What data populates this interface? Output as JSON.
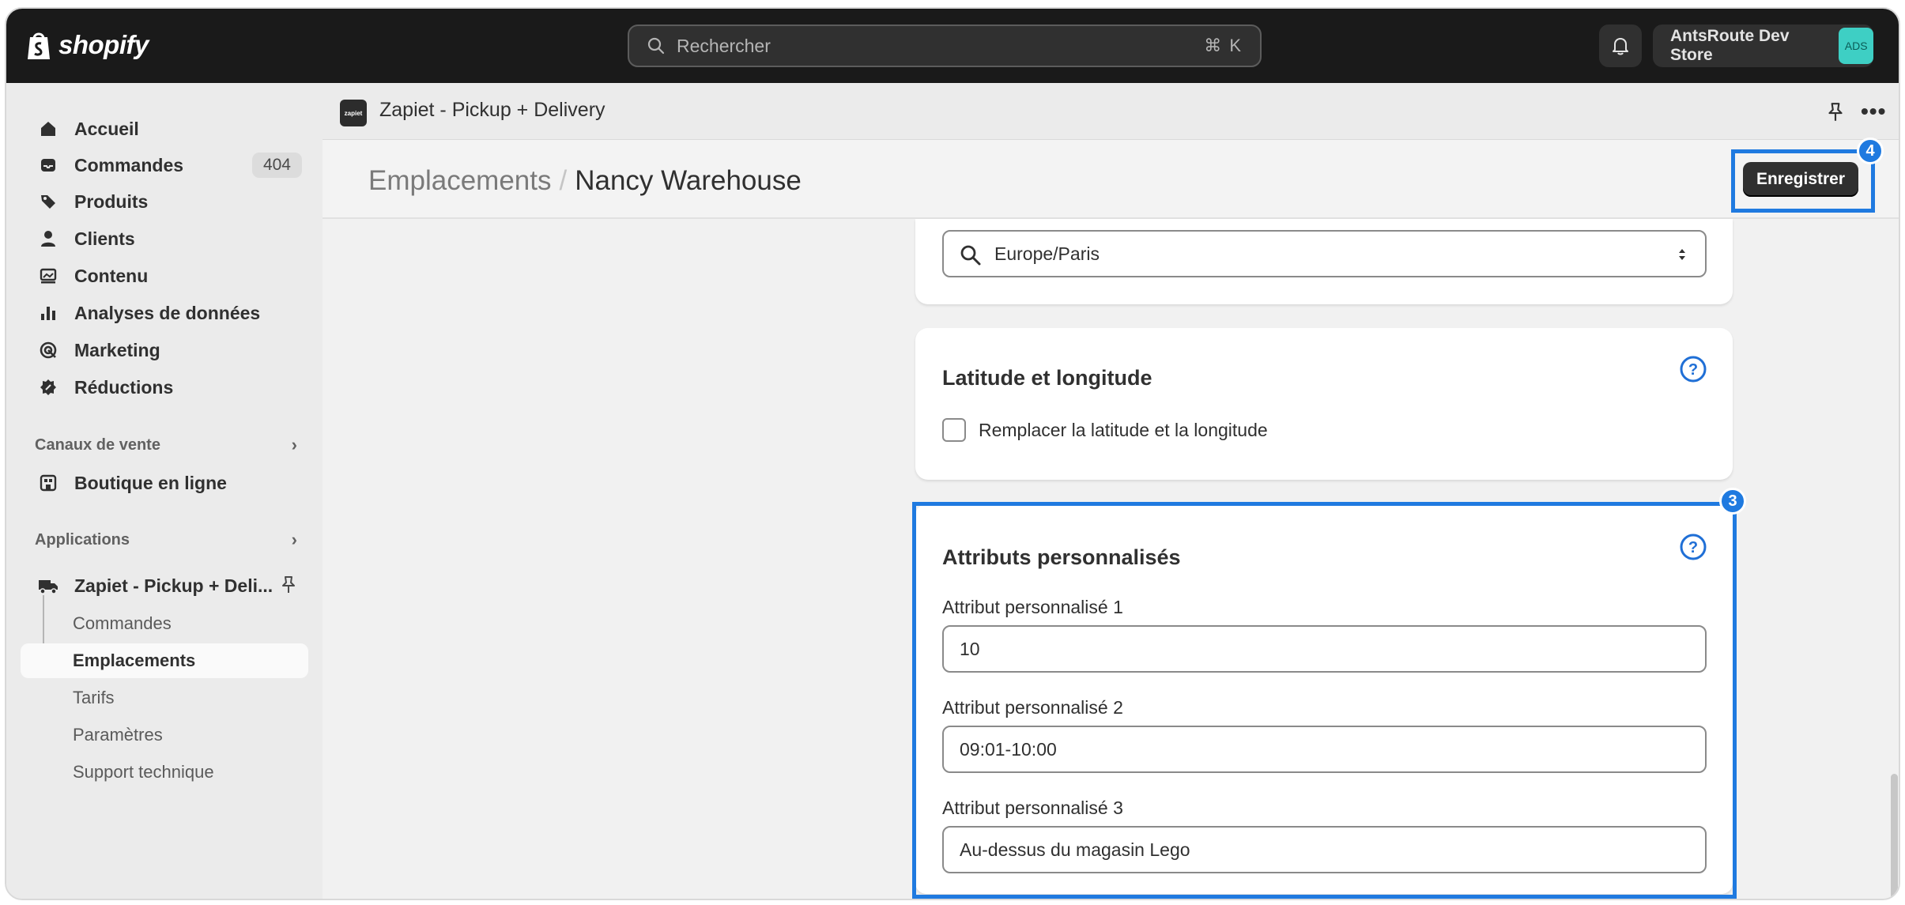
{
  "topbar": {
    "brand": "shopify",
    "search_placeholder": "Rechercher",
    "search_shortcut": "⌘ K",
    "store_name": "AntsRoute Dev Store",
    "store_avatar": "ADS",
    "icons": [
      "shopify-bag-icon",
      "search-icon",
      "bell-icon"
    ]
  },
  "sidebar": {
    "items": [
      {
        "label": "Accueil",
        "icon": "home-icon"
      },
      {
        "label": "Commandes",
        "icon": "inbox-icon",
        "badge": "404"
      },
      {
        "label": "Produits",
        "icon": "tag-icon"
      },
      {
        "label": "Clients",
        "icon": "person-icon"
      },
      {
        "label": "Contenu",
        "icon": "image-icon"
      },
      {
        "label": "Analyses de données",
        "icon": "bar-chart-icon"
      },
      {
        "label": "Marketing",
        "icon": "target-icon"
      },
      {
        "label": "Réductions",
        "icon": "discount-icon"
      }
    ],
    "sales_channels": {
      "label": "Canaux de vente",
      "items": [
        {
          "label": "Boutique en ligne",
          "icon": "store-icon"
        }
      ]
    },
    "apps": {
      "label": "Applications",
      "app": {
        "label": "Zapiet - Pickup + Deli...",
        "icon": "truck-icon"
      },
      "subitems": [
        "Commandes",
        "Emplacements",
        "Tarifs",
        "Paramètres",
        "Support technique"
      ],
      "active_subitem": "Emplacements"
    }
  },
  "app_bar": {
    "logo": "zapiet",
    "title": "Zapiet - Pickup + Delivery"
  },
  "page": {
    "breadcrumb_parent": "Emplacements",
    "breadcrumb_separator": "/",
    "title": "Nancy Warehouse",
    "save_label": "Enregistrer",
    "save_step": "4"
  },
  "timezone": {
    "value": "Europe/Paris"
  },
  "latlng": {
    "title": "Latitude et longitude",
    "checkbox_label": "Remplacer la latitude et la longitude",
    "checked": false
  },
  "attributes": {
    "title": "Attributs personnalisés",
    "step": "3",
    "fields": [
      {
        "label": "Attribut personnalisé 1",
        "value": "10"
      },
      {
        "label": "Attribut personnalisé 2",
        "value": "09:01-10:00"
      },
      {
        "label": "Attribut personnalisé 3",
        "value": "Au-dessus du magasin Lego"
      }
    ]
  },
  "colors": {
    "topbar": "#1a1a1a",
    "highlight": "#1f7ae0",
    "primary_button": "#303030",
    "avatar": "#3ecfc4"
  }
}
